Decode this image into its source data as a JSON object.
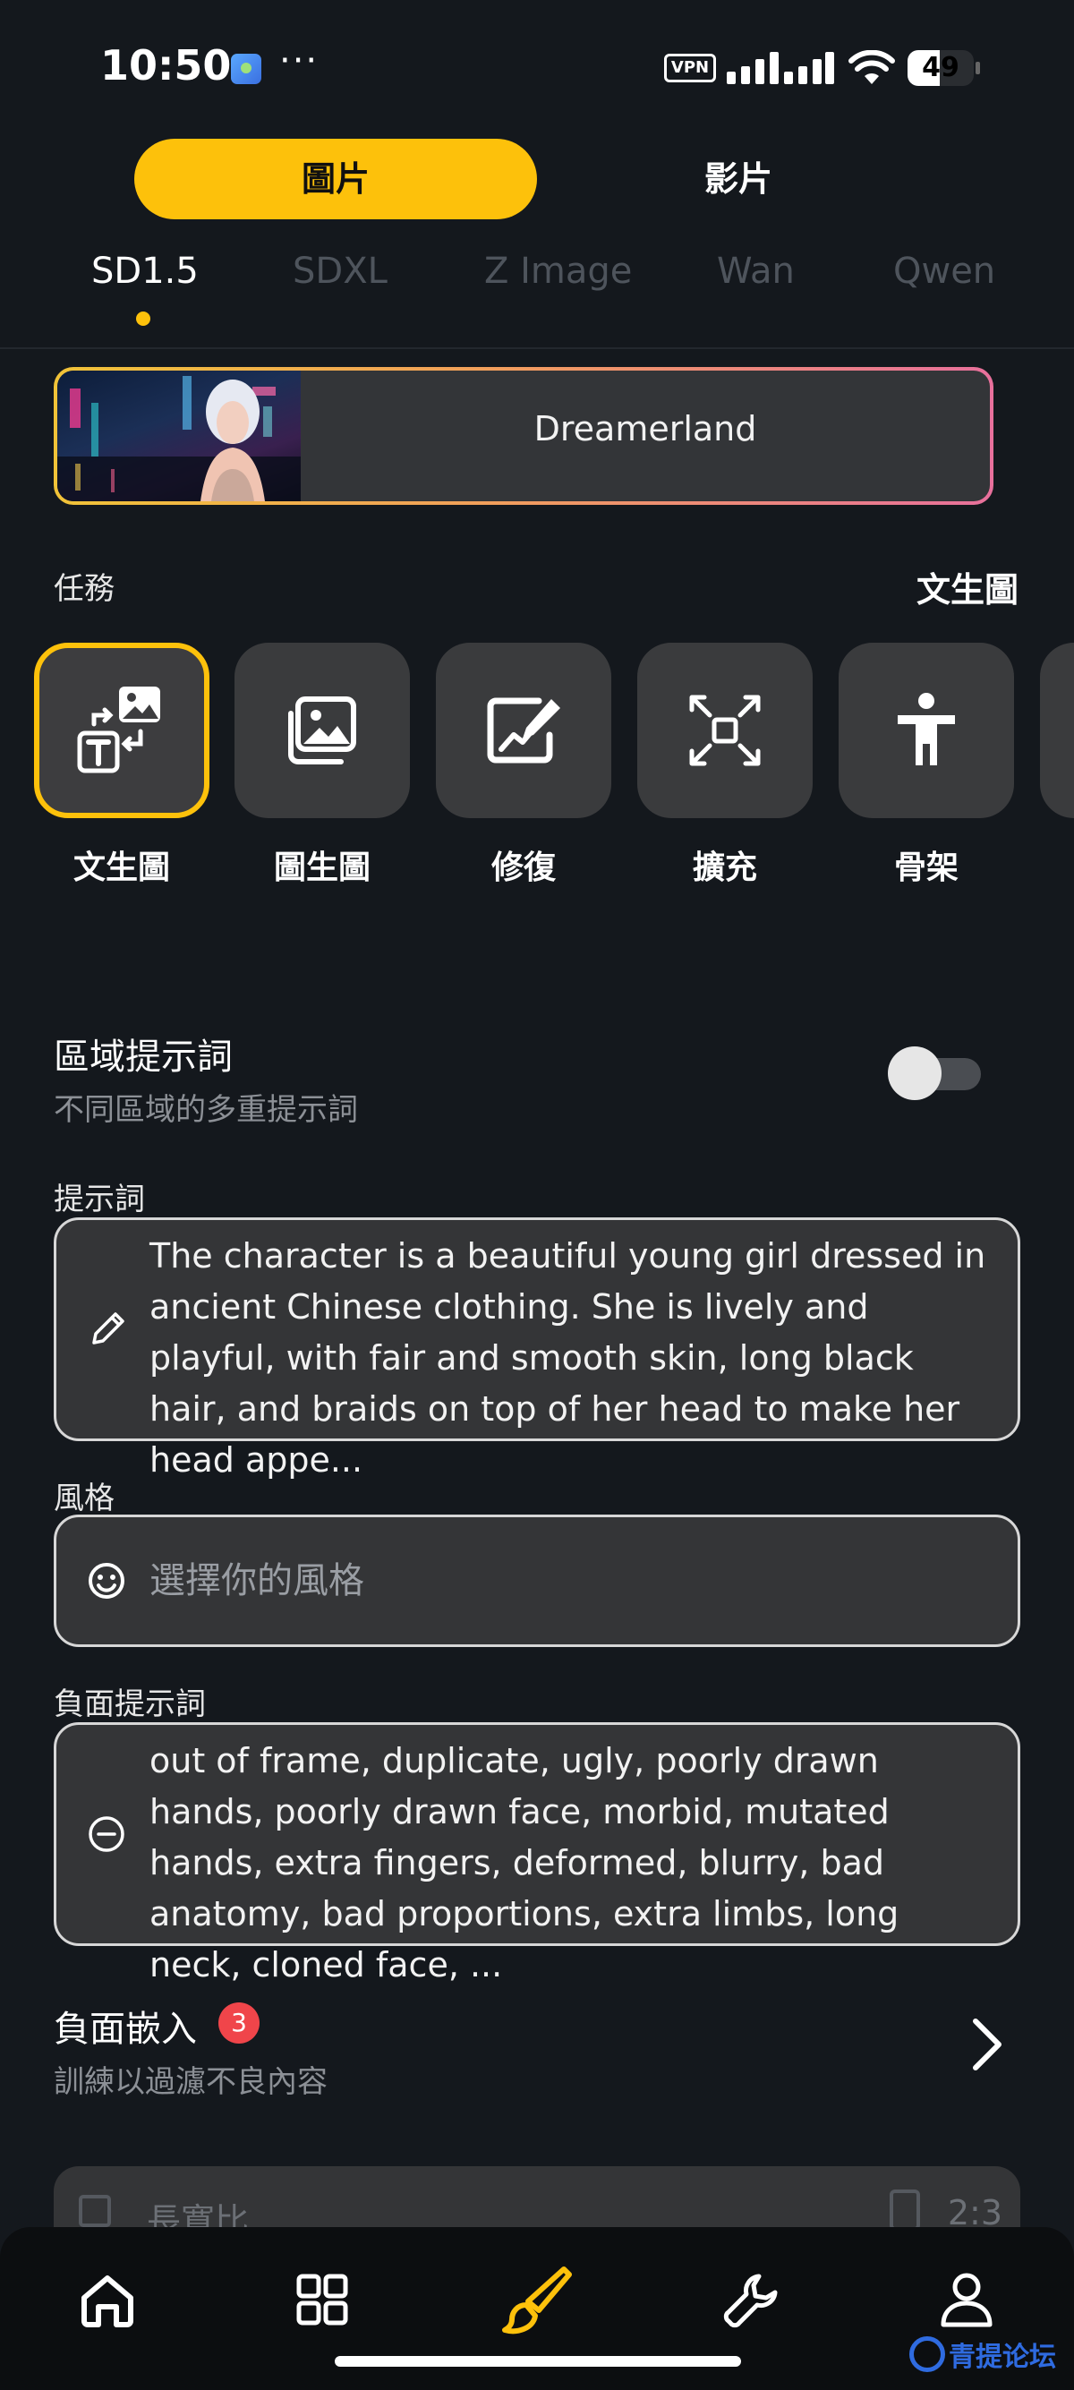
{
  "status_bar": {
    "time": "10:50",
    "more": "···",
    "vpn": "VPN",
    "battery_level": 49,
    "battery_text": "49"
  },
  "mode_toggle": {
    "active": "圖片",
    "other": "影片"
  },
  "model_tabs": [
    {
      "label": "SD1.5",
      "active": true
    },
    {
      "label": "SDXL",
      "active": false
    },
    {
      "label": "Z Image",
      "active": false
    },
    {
      "label": "Wan",
      "active": false
    },
    {
      "label": "Qwen",
      "active": false
    }
  ],
  "banner": {
    "label": "Dreamerland"
  },
  "task": {
    "header": "任務",
    "current": "文生圖",
    "items": [
      {
        "label": "文生圖",
        "icon": "text-to-image-icon",
        "selected": true
      },
      {
        "label": "圖生圖",
        "icon": "image-to-image-icon",
        "selected": false
      },
      {
        "label": "修復",
        "icon": "inpaint-icon",
        "selected": false
      },
      {
        "label": "擴充",
        "icon": "expand-icon",
        "selected": false
      },
      {
        "label": "骨架",
        "icon": "pose-icon",
        "selected": false
      }
    ]
  },
  "regional_prompt": {
    "title": "區域提示詞",
    "subtitle": "不同區域的多重提示詞",
    "enabled": false
  },
  "prompt": {
    "label": "提示詞",
    "value": "The character is a beautiful young girl dressed in ancient Chinese clothing. She is lively and playful, with fair and smooth skin, long black hair, and braids on top of her head to make her head appe..."
  },
  "style": {
    "label": "風格",
    "placeholder": "選擇你的風格"
  },
  "negative_prompt": {
    "label": "負面提示詞",
    "value": "out of frame, duplicate, ugly, poorly drawn hands, poorly drawn face, morbid, mutated hands, extra fingers, deformed, blurry, bad anatomy, bad proportions, extra limbs, long neck, cloned face, ..."
  },
  "negative_embedding": {
    "title": "負面嵌入",
    "badge": "3",
    "subtitle": "訓練以過濾不良內容"
  },
  "partial_card": {
    "label": "長寬比",
    "value": "2:3"
  },
  "bottom_nav": [
    {
      "icon": "home-icon",
      "active": false
    },
    {
      "icon": "grid-icon",
      "active": false
    },
    {
      "icon": "brush-icon",
      "active": true
    },
    {
      "icon": "wrench-icon",
      "active": false
    },
    {
      "icon": "profile-icon",
      "active": false
    }
  ],
  "watermark": "青提论坛",
  "colors": {
    "accent": "#fdc10b",
    "background": "#14181d",
    "card": "#343537",
    "badge": "#f0454a"
  }
}
